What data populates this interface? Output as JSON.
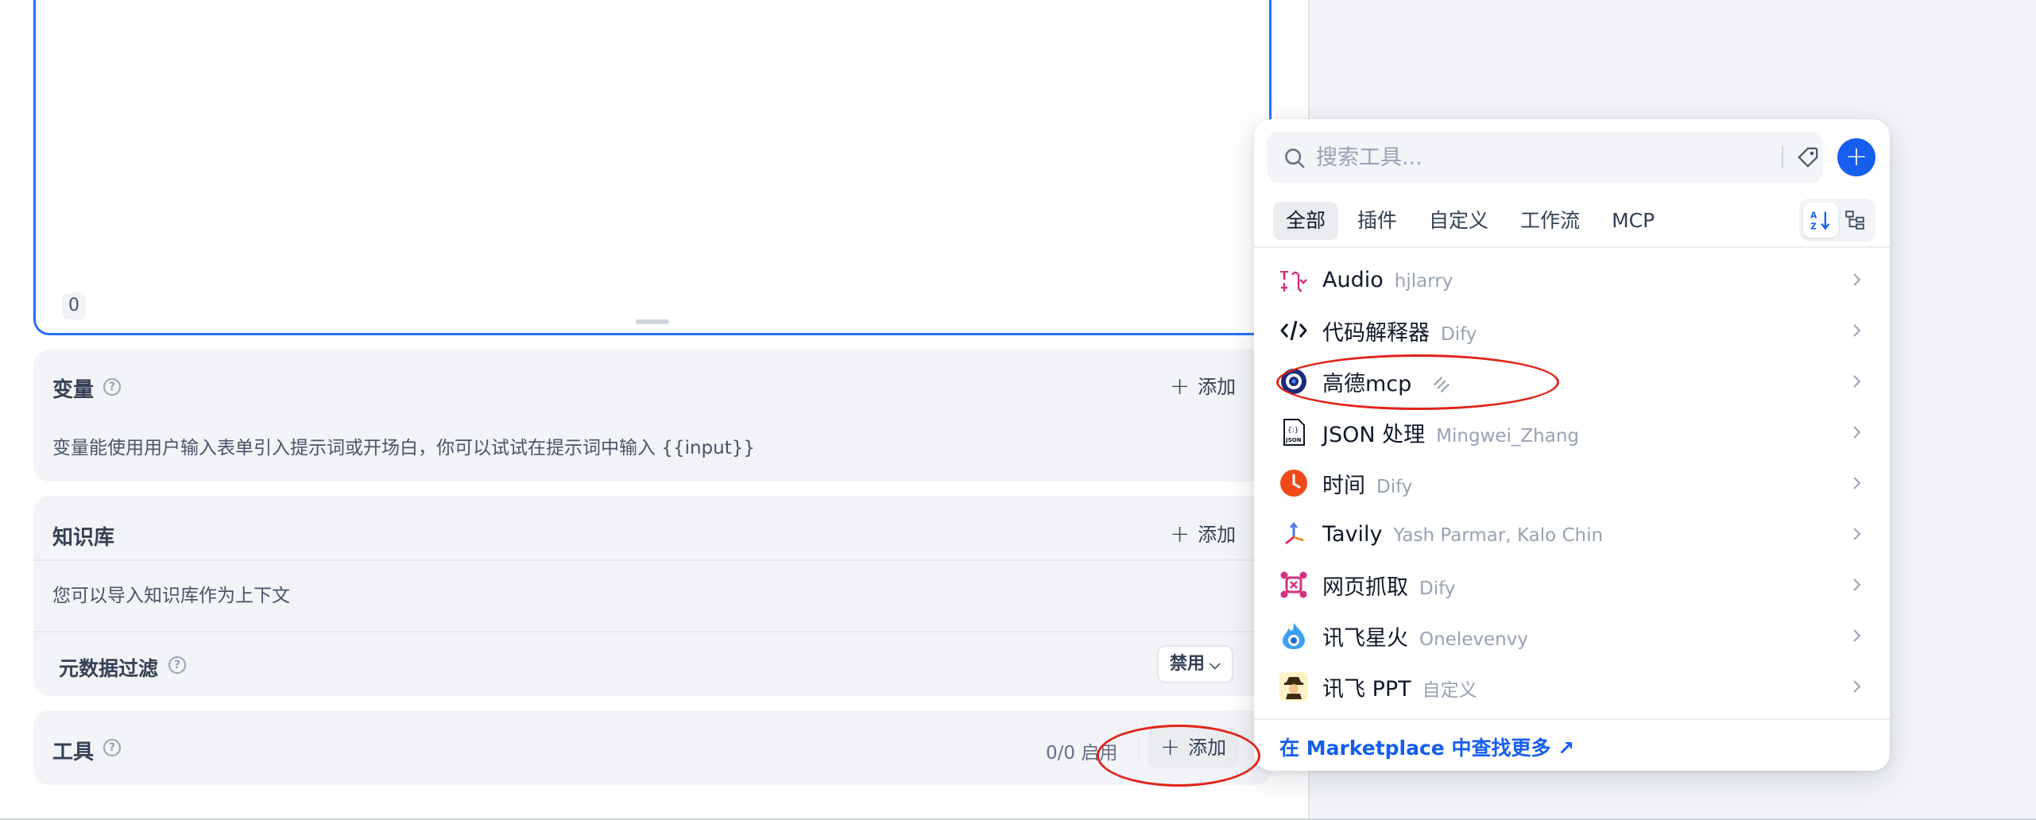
{
  "editor": {
    "char_count": "0"
  },
  "variables": {
    "title": "变量",
    "add_label": "添加",
    "description": "变量能使用用户输入表单引入提示词或开场白，你可以试试在提示词中输入 {{input}}"
  },
  "knowledge": {
    "title": "知识库",
    "add_label": "添加",
    "description": "您可以导入知识库作为上下文",
    "metadata_filter_label": "元数据过滤",
    "metadata_filter_value": "禁用"
  },
  "tools": {
    "title": "工具",
    "enabled_count": "0/0 启用",
    "add_label": "添加"
  },
  "tool_picker": {
    "search_placeholder": "搜索工具...",
    "tabs": [
      "全部",
      "插件",
      "自定义",
      "工作流",
      "MCP"
    ],
    "active_tab": "全部",
    "items": [
      {
        "name": "Audio",
        "author": "hjlarry",
        "icon": "audio-icon"
      },
      {
        "name": "代码解释器",
        "author": "Dify",
        "icon": "code-icon"
      },
      {
        "name": "高德mcp",
        "author": "",
        "icon": "amap-icon"
      },
      {
        "name": "JSON 处理",
        "author": "Mingwei_Zhang",
        "icon": "json-file-icon"
      },
      {
        "name": "时间",
        "author": "Dify",
        "icon": "clock-icon"
      },
      {
        "name": "Tavily",
        "author": "Yash Parmar, Kalo Chin",
        "icon": "tavily-icon"
      },
      {
        "name": "网页抓取",
        "author": "Dify",
        "icon": "webscraper-icon"
      },
      {
        "name": "讯飞星火",
        "author": "Onelevenvy",
        "icon": "spark-icon"
      },
      {
        "name": "讯飞 PPT",
        "author": "自定义",
        "icon": "ppt-agent-icon"
      }
    ],
    "marketplace_link": "在 Marketplace 中查找更多 ↗"
  },
  "colors": {
    "accent": "#155eef",
    "editor_border": "#2970ff",
    "annotation": "#e0251b"
  }
}
